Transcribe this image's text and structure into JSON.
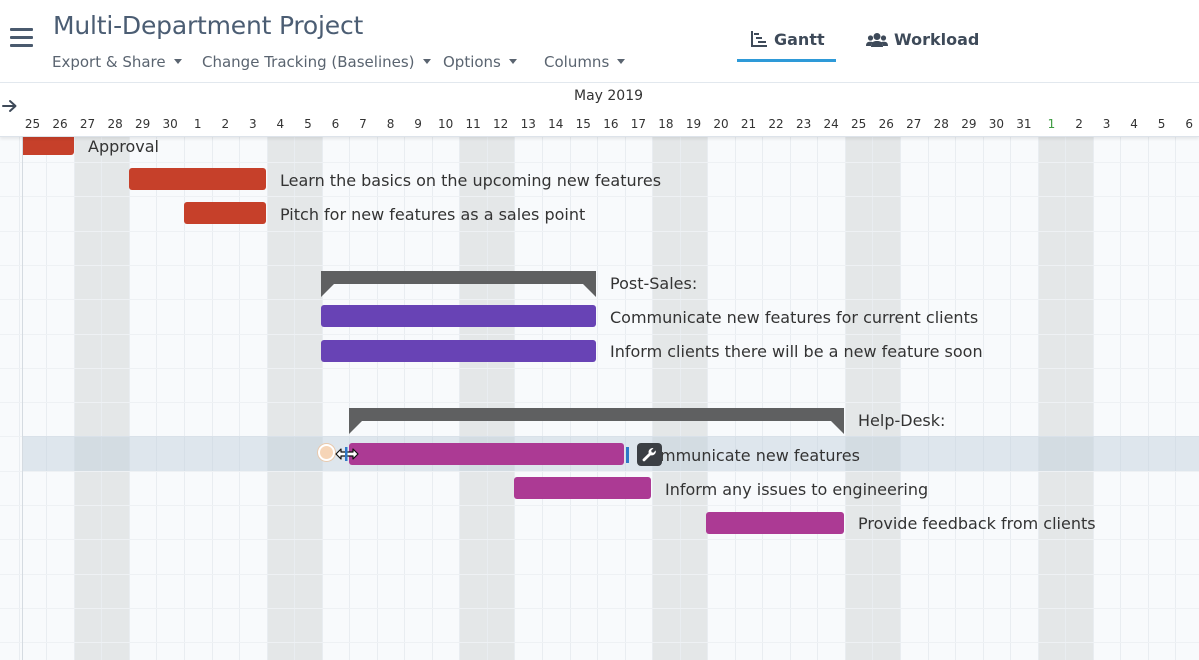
{
  "header": {
    "title": "Multi-Department Project",
    "menus": [
      {
        "label": "Export & Share"
      },
      {
        "label": "Change Tracking (Baselines)"
      },
      {
        "label": "Options"
      },
      {
        "label": "Columns"
      }
    ],
    "views": [
      {
        "label": "Gantt",
        "icon": "gantt-chart-icon",
        "active": true
      },
      {
        "label": "Workload",
        "icon": "users-icon",
        "active": false
      }
    ],
    "accent_color": "#2e9ad8"
  },
  "timeline": {
    "month": "May 2019",
    "days": [
      "25",
      "26",
      "27",
      "28",
      "29",
      "30",
      "1",
      "2",
      "3",
      "4",
      "5",
      "6",
      "7",
      "8",
      "9",
      "10",
      "11",
      "12",
      "13",
      "14",
      "15",
      "16",
      "17",
      "18",
      "19",
      "20",
      "21",
      "22",
      "23",
      "24",
      "25",
      "26",
      "27",
      "28",
      "29",
      "30",
      "31",
      "1",
      "2",
      "3",
      "4",
      "5",
      "6"
    ],
    "highlighted_days": [
      37
    ]
  },
  "tasks": [
    {
      "label": "Approval",
      "type": "task",
      "color": "#c6402a"
    },
    {
      "label": "Learn the basics on the upcoming new features",
      "type": "task",
      "color": "#c6402a"
    },
    {
      "label": "Pitch for new features as a sales point",
      "type": "task",
      "color": "#c6402a"
    },
    {
      "label": "Post-Sales:",
      "type": "group",
      "color": "#5f6061"
    },
    {
      "label": "Communicate new features for current clients",
      "type": "task",
      "color": "#6843b5"
    },
    {
      "label": "Inform clients there will be a new feature soon",
      "type": "task",
      "color": "#6843b5"
    },
    {
      "label": "Help-Desk:",
      "type": "group",
      "color": "#5f6061"
    },
    {
      "label": "mmunicate new features",
      "type": "task",
      "color": "#ac3a94",
      "selected": true
    },
    {
      "label": "Inform any issues to engineering",
      "type": "task",
      "color": "#ac3a94"
    },
    {
      "label": "Provide feedback from clients",
      "type": "task",
      "color": "#ac3a94"
    }
  ],
  "icons": {
    "menu": "hamburger-icon",
    "timeline_arrow": "arrow-right-icon",
    "task_tools": "wrench-icon"
  }
}
